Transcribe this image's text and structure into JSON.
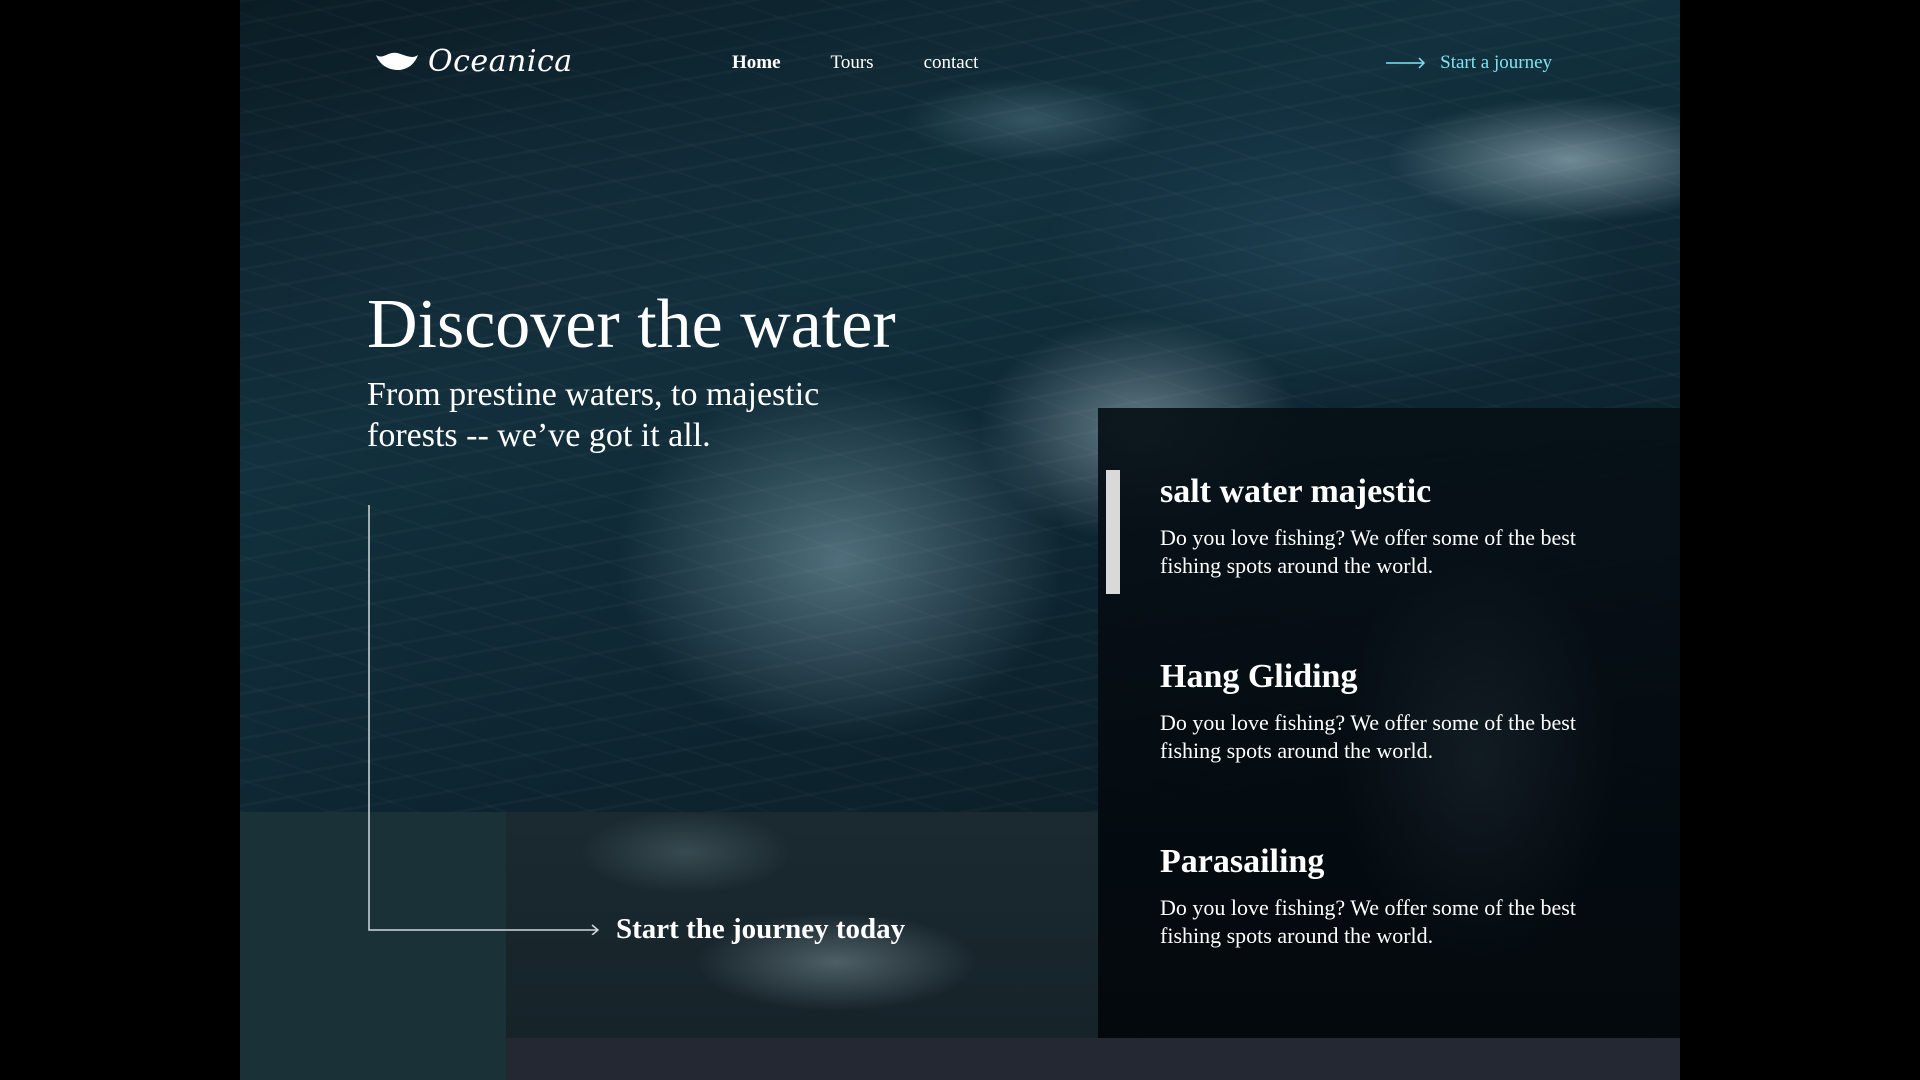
{
  "brand": {
    "name": "Oceanica"
  },
  "nav": {
    "items": [
      {
        "label": "Home",
        "active": true
      },
      {
        "label": "Tours",
        "active": false
      },
      {
        "label": "contact",
        "active": false
      }
    ],
    "cta_label": "Start a journey"
  },
  "hero": {
    "title": "Discover the water",
    "subtitle": "From prestine waters, to majestic forests -- we’ve got it all.",
    "journey_label": "Start the journey today"
  },
  "features": [
    {
      "title": "salt water majestic",
      "description": "Do you love fishing? We offer some of the best fishing spots around the world.",
      "selected": true
    },
    {
      "title": "Hang Gliding",
      "description": "Do you love fishing? We offer some of the best fishing spots around the world.",
      "selected": false
    },
    {
      "title": "Parasailing",
      "description": "Do you love fishing? We offer some of the best fishing spots around the world.",
      "selected": false
    }
  ],
  "colors": {
    "accent": "#7fe3f0",
    "left_panel": "#1b3138",
    "bottom_bar": "#242832",
    "page_background": "#000000"
  },
  "icons": {
    "logo": "shell-icon",
    "cta": "arrow-right-icon",
    "journey": "corner-arrow-icon"
  }
}
